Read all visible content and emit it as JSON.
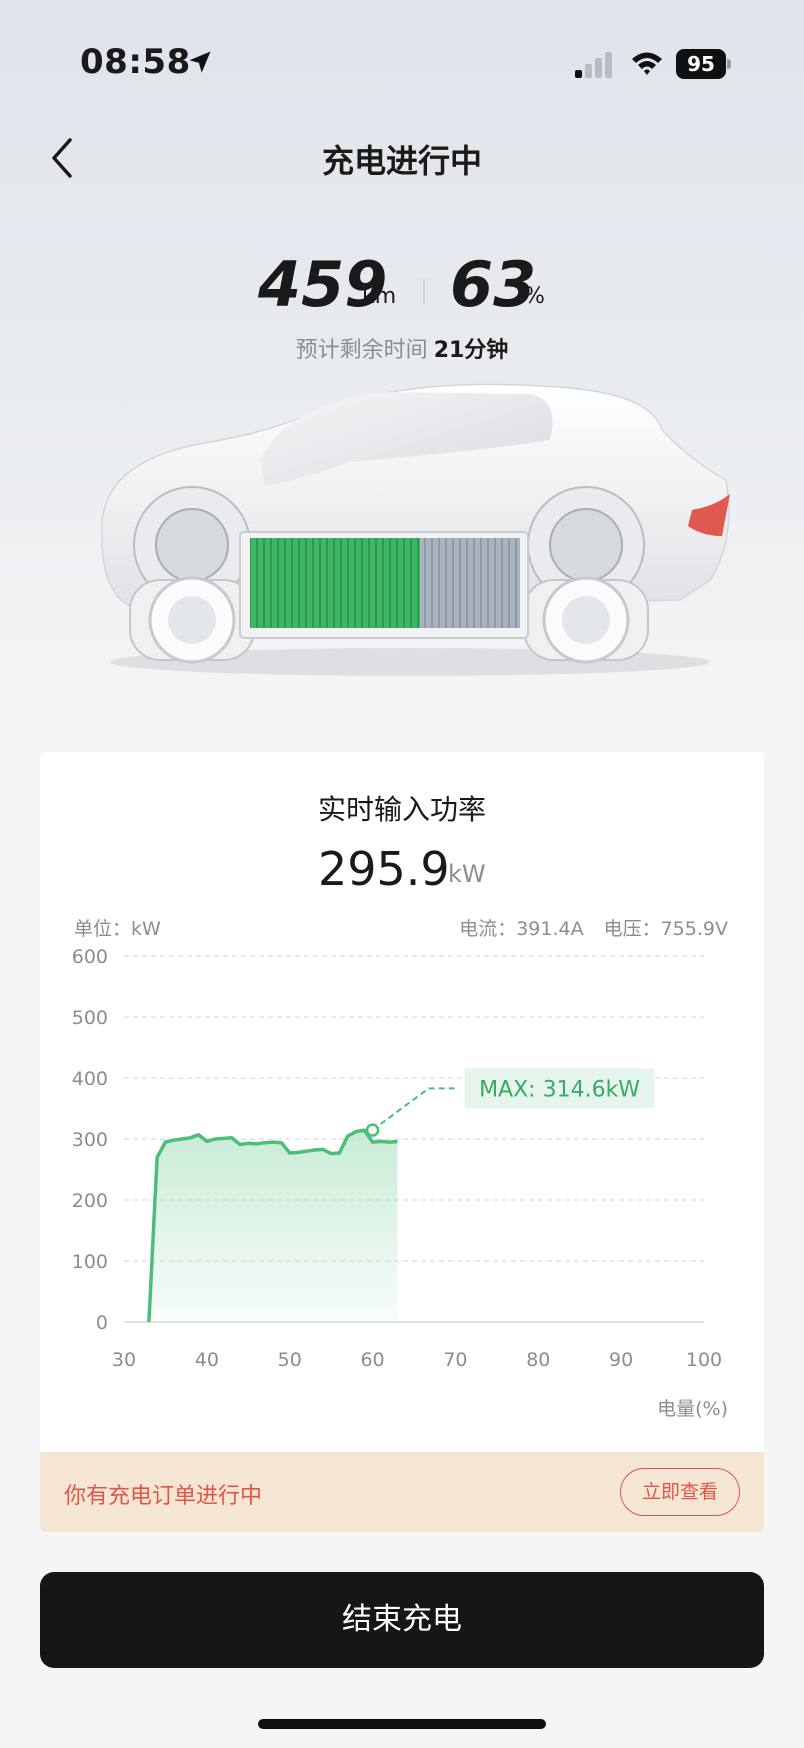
{
  "status_bar": {
    "time": "08:58",
    "battery_level": "95"
  },
  "header": {
    "title": "充电进行中"
  },
  "stats": {
    "range_value": "459",
    "range_unit": "km",
    "soc_value": "63",
    "soc_unit": "%",
    "eta_label": "预计剩余时间",
    "eta_value": "21分钟"
  },
  "illustration": {
    "battery_fill_fraction": 0.63
  },
  "power_card": {
    "title": "实时输入功率",
    "value": "295.9",
    "unit": "kW",
    "unit_label": "单位：kW",
    "current": "电流：391.4A",
    "voltage": "电压：755.9V",
    "x_axis_title": "电量(%)",
    "max_label": "MAX: 314.6kW"
  },
  "chart_data": {
    "type": "area",
    "title": "实时输入功率",
    "xlabel": "电量(%)",
    "ylabel": "单位：kW",
    "xlim": [
      30,
      100
    ],
    "ylim": [
      0,
      600
    ],
    "x_ticks": [
      "30",
      "40",
      "50",
      "60",
      "70",
      "80",
      "90",
      "100"
    ],
    "y_ticks": [
      "0",
      "100",
      "200",
      "300",
      "400",
      "500",
      "600"
    ],
    "grid": true,
    "series": [
      {
        "x": [
          33,
          34,
          35,
          36,
          37,
          38,
          39,
          40,
          41,
          42,
          43,
          44,
          45,
          46,
          47,
          48,
          49,
          50,
          51,
          52,
          53,
          54,
          55,
          56,
          57,
          58,
          59,
          60,
          61,
          62,
          63
        ],
        "values": [
          0,
          270,
          295,
          298,
          300,
          302,
          307,
          296,
          300,
          301,
          302,
          291,
          293,
          292,
          294,
          295,
          294,
          277,
          278,
          280,
          282,
          283,
          276,
          277,
          305,
          312,
          314.6,
          295,
          296,
          295,
          295.9
        ]
      }
    ],
    "max_point": {
      "x": 60,
      "y": 314.6
    },
    "colors": {
      "line": "#4dbd7a",
      "fill": "#bfe8cf",
      "grid": "#d9d9d9",
      "max_label_bg": "#e6f5eb",
      "max_label_text": "#3aa866"
    }
  },
  "order_banner": {
    "text": "你有充电订单进行中",
    "button_label": "立即查看"
  },
  "footer": {
    "end_button_label": "结束充电"
  }
}
